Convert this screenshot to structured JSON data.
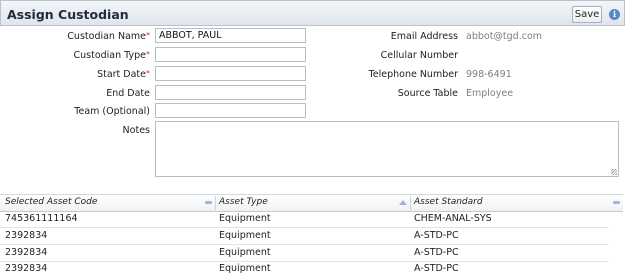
{
  "header": {
    "title": "Assign Custodian",
    "save_label": "Save",
    "info_icon": "i"
  },
  "form": {
    "custodian_name_label": "Custodian Name",
    "custodian_name_value": "ABBOT, PAUL",
    "custodian_type_label": "Custodian Type",
    "start_date_label": "Start Date",
    "end_date_label": "End Date",
    "team_label": "Team (Optional)",
    "notes_label": "Notes",
    "required_mark": "*"
  },
  "details": {
    "email_label": "Email Address",
    "email_value": "abbot@tgd.com",
    "cellular_label": "Cellular Number",
    "cellular_value": "",
    "telephone_label": "Telephone Number",
    "telephone_value": "998-6491",
    "source_label": "Source Table",
    "source_value": "Employee"
  },
  "grid": {
    "columns": [
      "Selected Asset Code",
      "Asset Type",
      "Asset Standard"
    ],
    "rows": [
      [
        "745361111164",
        "Equipment",
        "CHEM-ANAL-SYS"
      ],
      [
        "2392834",
        "Equipment",
        "A-STD-PC"
      ],
      [
        "2392834",
        "Equipment",
        "A-STD-PC"
      ],
      [
        "2392834",
        "Equipment",
        "A-STD-PC"
      ]
    ]
  }
}
